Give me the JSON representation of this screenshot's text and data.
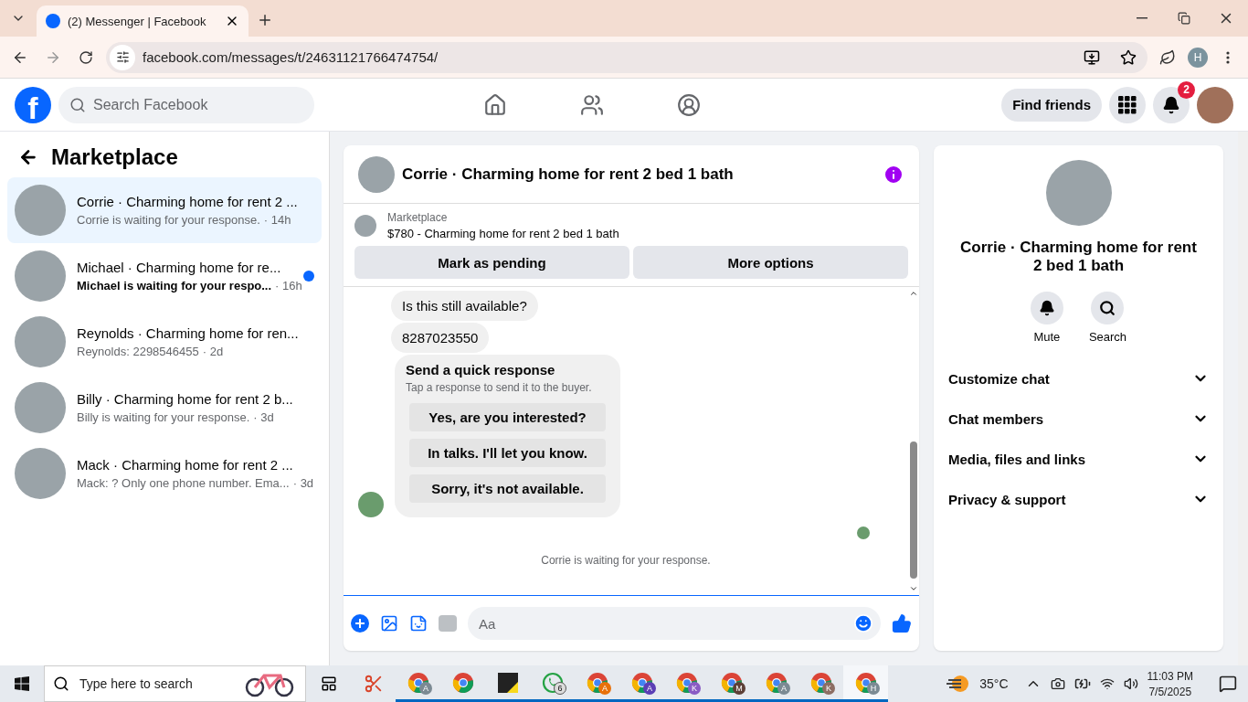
{
  "browser": {
    "tab_title": "(2) Messenger | Facebook",
    "url": "facebook.com/messages/t/24631121766474754/",
    "profile_initial": "H"
  },
  "header": {
    "logo_letter": "f",
    "search_placeholder": "Search Facebook",
    "find_friends": "Find friends",
    "notification_count": "2"
  },
  "sidebar": {
    "title": "Marketplace",
    "conversations": [
      {
        "title": "Corrie · Charming home for rent 2 ...",
        "preview": "Corrie is waiting for your response.",
        "time": "· 14h",
        "selected": true,
        "unread": false
      },
      {
        "title": "Michael · Charming home for re...",
        "preview": "Michael is waiting for your respo...",
        "time": "· 16h",
        "selected": false,
        "unread": true
      },
      {
        "title": "Reynolds · Charming home for ren...",
        "preview": "Reynolds: 2298546455",
        "time": "· 2d",
        "selected": false,
        "unread": false
      },
      {
        "title": "Billy · Charming home for rent 2 b...",
        "preview": "Billy is waiting for your response.",
        "time": "· 3d",
        "selected": false,
        "unread": false
      },
      {
        "title": "Mack · Charming home for rent 2 ...",
        "preview": "Mack: ? Only one phone number. Ema...",
        "time": "· 3d",
        "selected": false,
        "unread": false
      }
    ]
  },
  "chat": {
    "title": "Corrie · Charming home for rent 2 bed 1 bath",
    "listing_label": "Marketplace",
    "listing": "$780 - Charming home for rent 2 bed 1 bath",
    "actions": [
      "Mark as pending",
      "More options"
    ],
    "messages": [
      "Is this still available?",
      "8287023550"
    ],
    "quick_response": {
      "title": "Send a quick response",
      "subtitle": "Tap a response to send it to the buyer.",
      "options": [
        "Yes, are you interested?",
        "In talks. I'll let you know.",
        "Sorry, it's not available."
      ]
    },
    "status": "Corrie is waiting for your response.",
    "composer_placeholder": "Aa"
  },
  "details": {
    "name": "Corrie · Charming home for rent 2 bed 1 bath",
    "actions": [
      {
        "kind": "mute",
        "label": "Mute"
      },
      {
        "kind": "search",
        "label": "Search"
      }
    ],
    "sections": [
      "Customize chat",
      "Chat members",
      "Media, files and links",
      "Privacy & support"
    ]
  },
  "taskbar": {
    "search_placeholder": "Type here to search",
    "apps": [
      {
        "kind": "snip",
        "selected": false
      },
      {
        "kind": "chrome",
        "badge": "A",
        "color": "#7b8a93",
        "selected": false
      },
      {
        "kind": "chrome",
        "selected": false
      },
      {
        "kind": "sticky",
        "selected": false
      },
      {
        "kind": "whatsapp",
        "badge": "6",
        "selected": false
      },
      {
        "kind": "chrome",
        "badge": "A",
        "color": "#e8710a",
        "selected": false
      },
      {
        "kind": "chrome",
        "badge": "A",
        "color": "#5b3fb5",
        "selected": false
      },
      {
        "kind": "chrome",
        "badge": "K",
        "color": "#8a5cc4",
        "selected": false
      },
      {
        "kind": "chrome",
        "badge": "M",
        "color": "#5d4037",
        "selected": false
      },
      {
        "kind": "chrome",
        "badge": "A",
        "color": "#7b8a93",
        "selected": false
      },
      {
        "kind": "chrome",
        "badge": "K",
        "color": "#8d6e63",
        "selected": false
      },
      {
        "kind": "chrome",
        "badge": "H",
        "color": "#7b8a93",
        "selected": true
      }
    ],
    "weather": "35°C",
    "time": "11:03 PM",
    "date": "7/5/2025"
  }
}
